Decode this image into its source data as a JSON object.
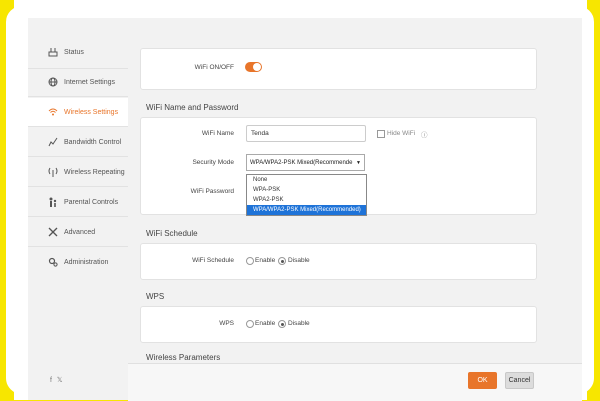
{
  "sidebar": {
    "items": [
      {
        "label": "Status",
        "icon": "router-icon"
      },
      {
        "label": "Internet Settings",
        "icon": "globe-icon"
      },
      {
        "label": "Wireless Settings",
        "icon": "wifi-icon"
      },
      {
        "label": "Bandwidth Control",
        "icon": "chart-icon"
      },
      {
        "label": "Wireless Repeating",
        "icon": "antenna-icon"
      },
      {
        "label": "Parental Controls",
        "icon": "family-icon"
      },
      {
        "label": "Advanced",
        "icon": "tools-icon"
      },
      {
        "label": "Administration",
        "icon": "gears-icon"
      }
    ],
    "social": "f  𝕦"
  },
  "wifi_onoff": {
    "label": "WiFi ON/OFF",
    "state": "on"
  },
  "wifi_name_password": {
    "title": "WiFi Name and Password",
    "name_label": "WiFi Name",
    "name_value": "Tenda",
    "hide_wifi_label": "Hide WiFi",
    "security_label": "Security Mode",
    "security_value": "WPA/WPA2-PSK Mixed(Recommende",
    "security_options": [
      "None",
      "WPA-PSK",
      "WPA2-PSK",
      "WPA/WPA2-PSK Mixed(Recommended)"
    ],
    "password_label": "WiFi Password"
  },
  "wifi_schedule": {
    "title": "WiFi Schedule",
    "label": "WiFi Schedule",
    "enable": "Enable",
    "disable": "Disable"
  },
  "wps": {
    "title": "WPS",
    "label": "WPS",
    "enable": "Enable",
    "disable": "Disable"
  },
  "wireless_parameters": {
    "title": "Wireless Parameters"
  },
  "buttons": {
    "ok": "OK",
    "cancel": "Cancel"
  },
  "colors": {
    "accent": "#e8752a",
    "highlight": "#1e73d8",
    "frame": "#f7e600"
  }
}
